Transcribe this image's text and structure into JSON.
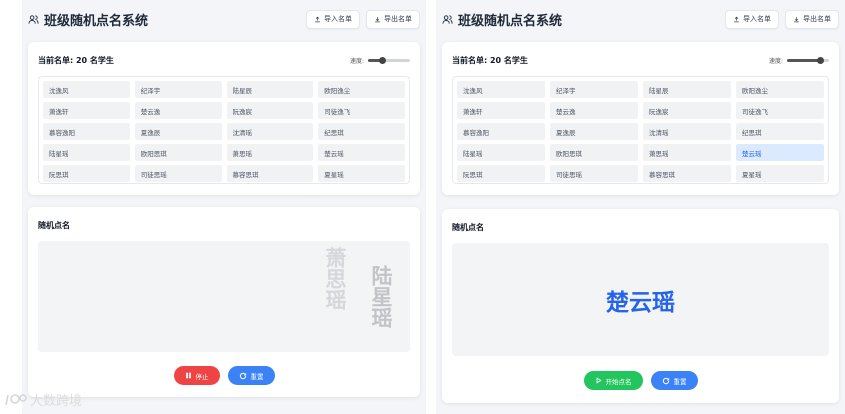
{
  "app": {
    "title": "班级随机点名系统"
  },
  "header": {
    "import_label": "导入名单",
    "export_label": "导出名单"
  },
  "roster": {
    "title": "当前名单: 20 名学生",
    "speed_label": "速度:",
    "left_speed_level": 0.35,
    "right_speed_level": 0.8,
    "students": [
      "沈逸风",
      "纪泽宇",
      "陆星辰",
      "欧阳逸尘",
      "萧逸轩",
      "楚云逸",
      "阮逸宸",
      "司徒逸飞",
      "慕容逸阳",
      "夏逸辰",
      "沈清瑶",
      "纪思琪",
      "陆星瑶",
      "欧阳思琪",
      "萧思瑶",
      "楚云瑶",
      "阮思琪",
      "司徒思瑶",
      "慕容思琪",
      "夏星瑶"
    ],
    "highlighted_index": 15
  },
  "call": {
    "title": "随机点名",
    "rolling_names": [
      "萧思瑶",
      "陆星瑶"
    ],
    "result_name": "楚云瑶",
    "stop_label": "停止",
    "reset_label": "重置",
    "start_label": "开始点名"
  },
  "watermark": {
    "text": "大数跨境"
  },
  "colors": {
    "accent": "#3b82f6",
    "stop": "#ef4444",
    "start": "#22c55e",
    "highlight_bg": "#dbeafe"
  }
}
